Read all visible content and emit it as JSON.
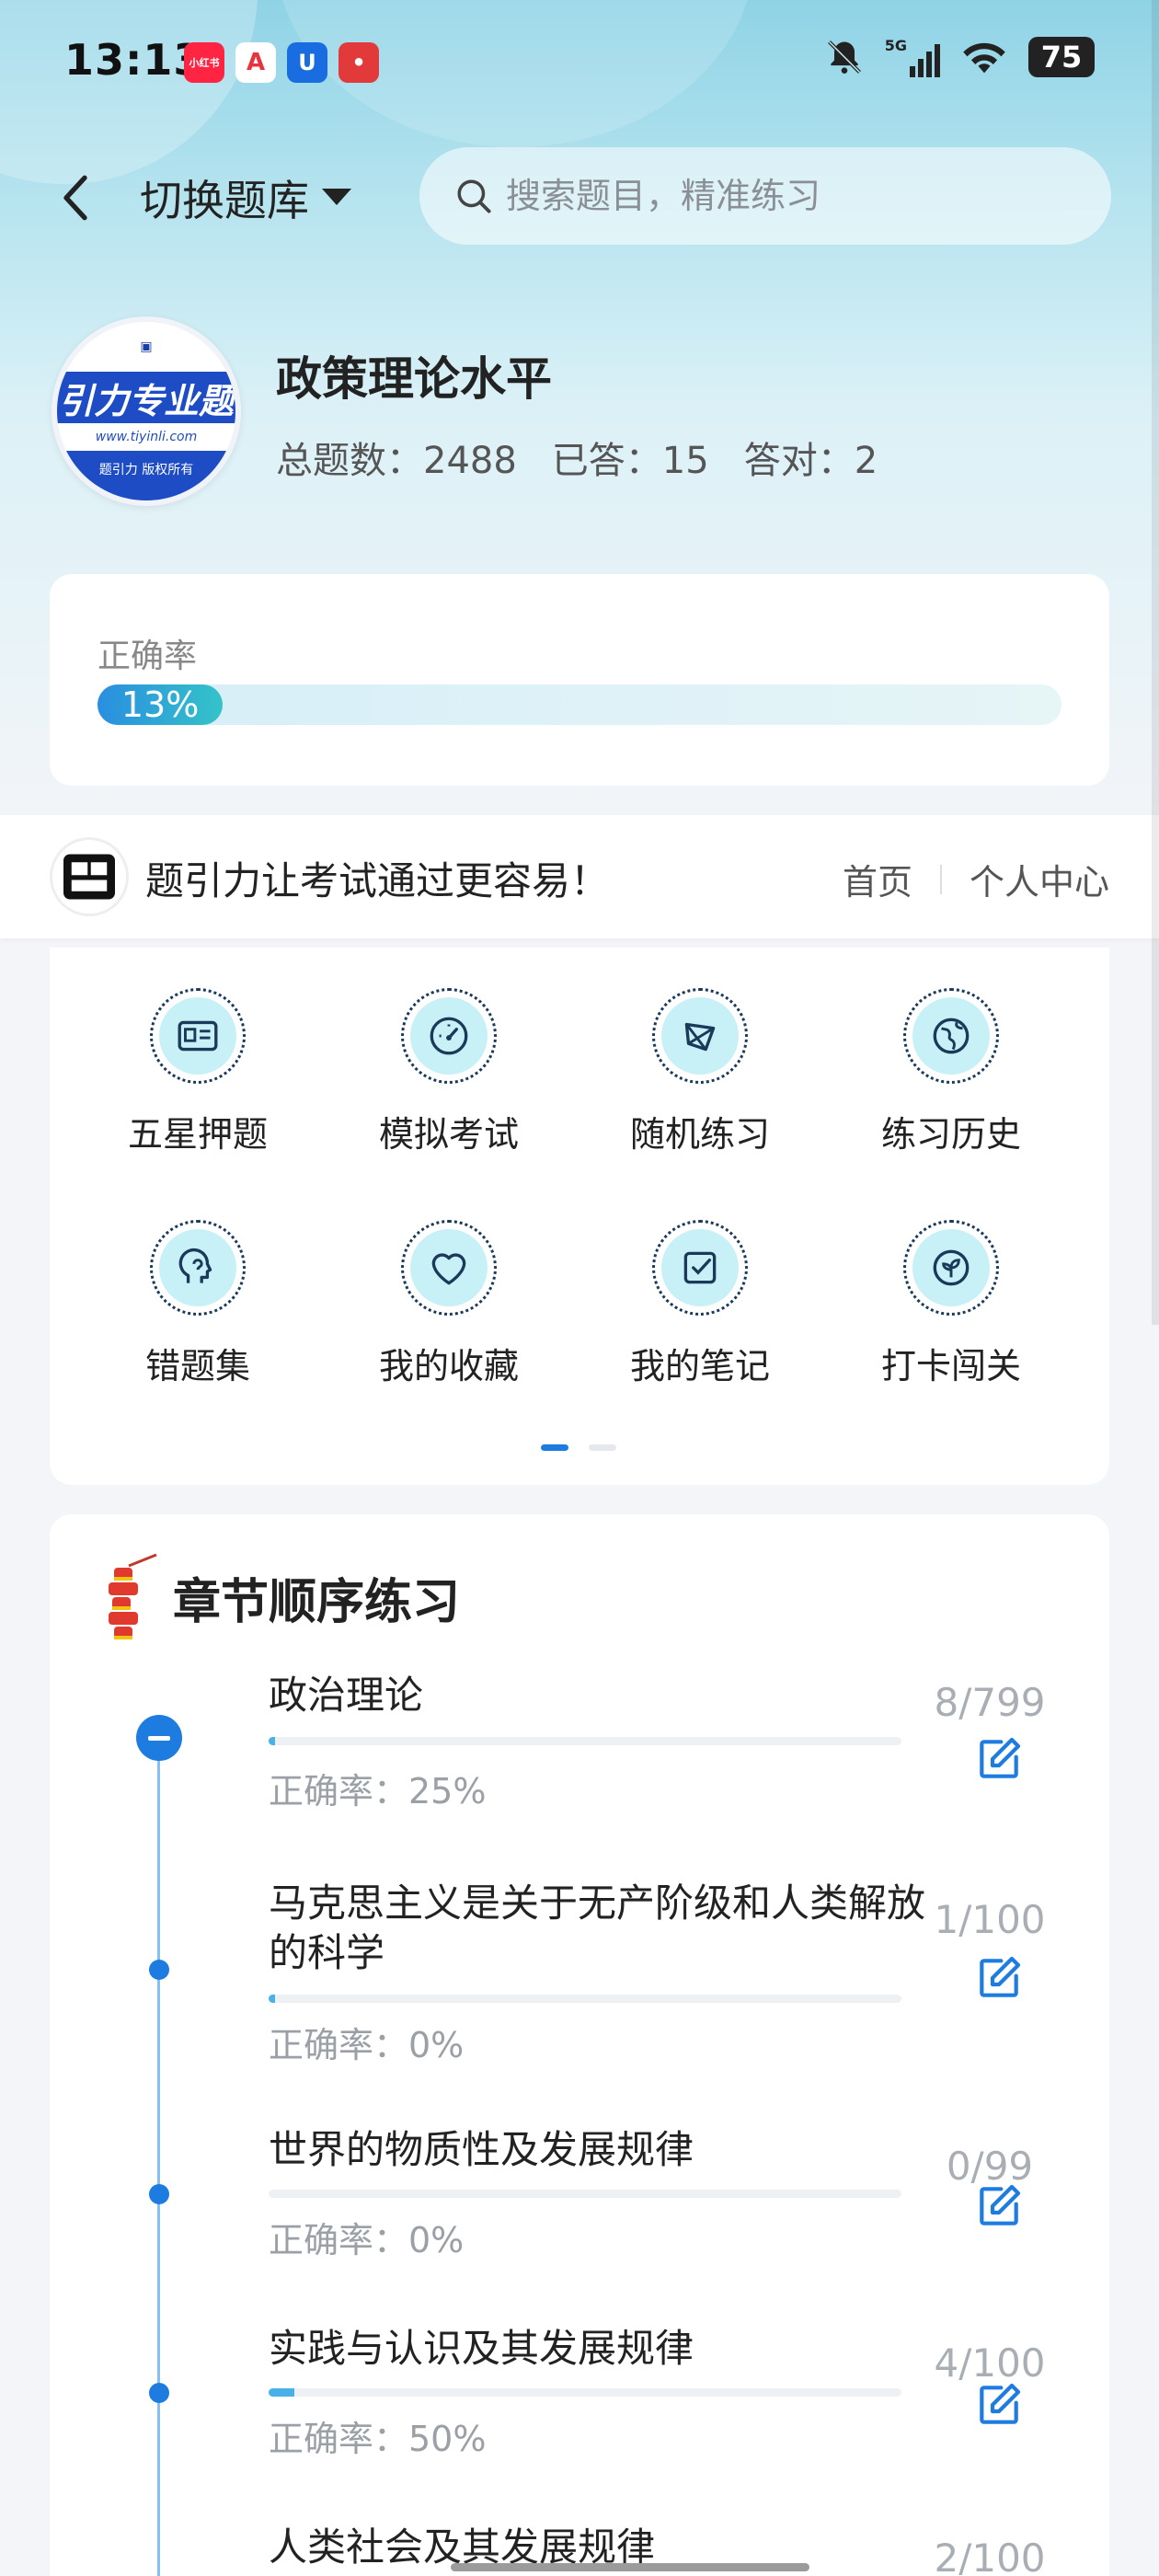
{
  "status_bar": {
    "time": "13:13",
    "apps": [
      {
        "name": "xiaohongshu-icon",
        "label": "小红书",
        "color": "#ff2442"
      },
      {
        "name": "app-a-icon",
        "label": "A",
        "color": "#e8323c"
      },
      {
        "name": "app-u-icon",
        "label": "U",
        "color": "#1a6de0"
      },
      {
        "name": "app-red-icon",
        "label": "•",
        "color": "#e23a3a"
      }
    ],
    "network": "5G",
    "battery": "75"
  },
  "header": {
    "switch_label": "切换题库",
    "search_placeholder": "搜索题目，精准练习"
  },
  "profile": {
    "logo_band": "引力专业题",
    "logo_url": "www.tiyinli.com",
    "logo_copy": "题引力 版权所有",
    "title": "政策理论水平",
    "total": "总题数：2488",
    "answered": "已答：15",
    "correct": "答对：2"
  },
  "accuracy": {
    "label": "正确率",
    "value_text": "13%",
    "value": 0.13
  },
  "promo": {
    "text": "题引力让考试通过更容易！",
    "link_home": "首页",
    "link_profile": "个人中心"
  },
  "grid": {
    "items": [
      {
        "label": "五星押题",
        "icon": "id-card-icon"
      },
      {
        "label": "模拟考试",
        "icon": "gauge-icon"
      },
      {
        "label": "随机练习",
        "icon": "shuffle-icon"
      },
      {
        "label": "练习历史",
        "icon": "globe-icon"
      },
      {
        "label": "错题集",
        "icon": "head-icon"
      },
      {
        "label": "我的收藏",
        "icon": "heart-icon"
      },
      {
        "label": "我的笔记",
        "icon": "note-check-icon"
      },
      {
        "label": "打卡闯关",
        "icon": "leaf-icon"
      }
    ]
  },
  "chapters": {
    "title": "章节顺序练习",
    "items": [
      {
        "name": "政治理论",
        "accuracy": "正确率：25%",
        "count": "8/799",
        "progress": 0.01
      },
      {
        "name": "马克思主义是关于无产阶级和人类解放的科学",
        "accuracy": "正确率：0%",
        "count": "1/100",
        "progress": 0.01
      },
      {
        "name": "世界的物质性及发展规律",
        "accuracy": "正确率：0%",
        "count": "0/99",
        "progress": 0
      },
      {
        "name": "实践与认识及其发展规律",
        "accuracy": "正确率：50%",
        "count": "4/100",
        "progress": 0.04
      },
      {
        "name": "人类社会及其发展规律",
        "accuracy": "",
        "count": "2/100",
        "progress": 0.02
      }
    ]
  },
  "colors": {
    "accent": "#1e7ce0",
    "teal": "#34c3c9"
  }
}
